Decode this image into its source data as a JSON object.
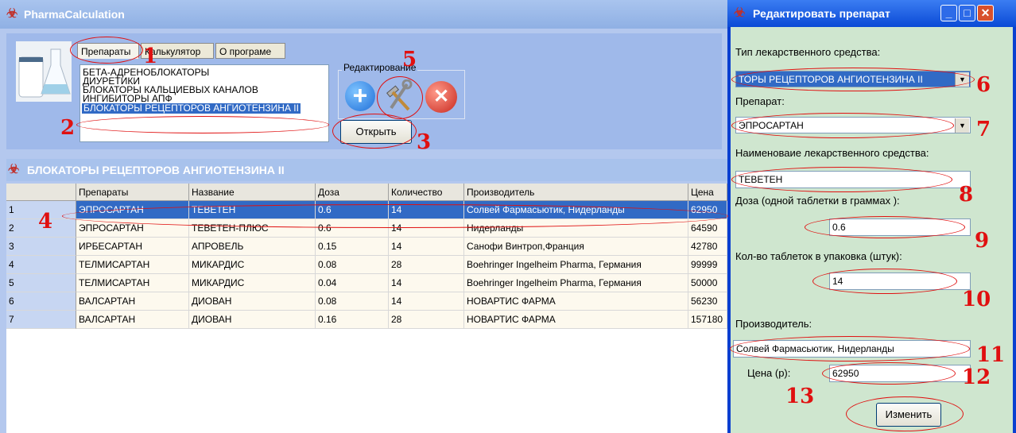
{
  "main": {
    "title": "PharmaCalculation",
    "tabs": [
      "Препараты",
      "Калькулятор",
      "О програме"
    ],
    "categories": [
      "БЕТА-АДРЕНОБЛОКАТОРЫ",
      "ДИУРЕТИКИ",
      "БЛОКАТОРЫ КАЛЬЦИЕВЫХ КАНАЛОВ",
      "ИНГИБИТОРЫ АПФ",
      "БЛОКАТОРЫ РЕЦЕПТОРОВ АНГИОТЕНЗИНА II"
    ],
    "edit_group_label": "Редактирование",
    "add_icon": "+",
    "delete_icon": "✕",
    "open_button": "Открыть",
    "grid_title": "БЛОКАТОРЫ РЕЦЕПТОРОВ АНГИОТЕНЗИНА II",
    "columns": [
      "Препараты",
      "Название",
      "Доза",
      "Количество",
      "Производитель",
      "Цена"
    ],
    "rows": [
      [
        "1",
        "ЭПРОСАРТАН",
        "ТЕВЕТЕН",
        "0.6",
        "14",
        "Солвей Фармасьютик, Нидерланды",
        "62950"
      ],
      [
        "2",
        "ЭПРОСАРТАН",
        "ТЕВЕТЕН-ПЛЮС",
        "0.6",
        "14",
        "Нидерланды",
        "64590"
      ],
      [
        "3",
        "ИРБЕСАРТАН",
        "АПРОВЕЛЬ",
        "0.15",
        "14",
        "Санофи Винтроп,Франция",
        "42780"
      ],
      [
        "4",
        "ТЕЛМИСАРТАН",
        "МИКАРДИС",
        "0.08",
        "28",
        "Boehringer Ingelheim Pharma, Германия",
        "99999"
      ],
      [
        "5",
        "ТЕЛМИСАРТАН",
        "МИКАРДИС",
        "0.04",
        "14",
        "Boehringer Ingelheim Pharma, Германия",
        "50000"
      ],
      [
        "6",
        "ВАЛСАРТАН",
        "ДИОВАН",
        "0.08",
        "14",
        "НОВАРТИС ФАРМА",
        "56230"
      ],
      [
        "7",
        "ВАЛСАРТАН",
        "ДИОВАН",
        "0.16",
        "28",
        "НОВАРТИС ФАРМА",
        "157180"
      ]
    ]
  },
  "dialog": {
    "title": "Редактировать препарат",
    "type_label": "Тип лекарственного средства:",
    "type_value": "ТОРЫ РЕЦЕПТОРОВ АНГИОТЕНЗИНА II",
    "drug_label": "Препарат:",
    "drug_value": "ЭПРОСАРТАН",
    "name_label": "Наименоваие  лекарственного средства:",
    "name_value": "ТЕВЕТЕН",
    "dose_label": "Доза (одной таблетки в граммах ):",
    "dose_value": "0.6",
    "qty_label": "Кол-во таблеток в упаковка (штук):",
    "qty_value": "14",
    "maker_label": "Производитель:",
    "maker_value": "Солвей Фармасьютик, Нидерланды",
    "price_label": "Цена (р):",
    "price_value": "62950",
    "change_button": "Изменить"
  },
  "annotations": [
    "1",
    "2",
    "3",
    "4",
    "5",
    "6",
    "7",
    "8",
    "9",
    "10",
    "11",
    "12",
    "13"
  ],
  "colors": {
    "annotation": "#e01010",
    "selection": "#316ac5",
    "dialog_bg": "#cfe6cf",
    "titlebar": "#0a4ad6"
  }
}
